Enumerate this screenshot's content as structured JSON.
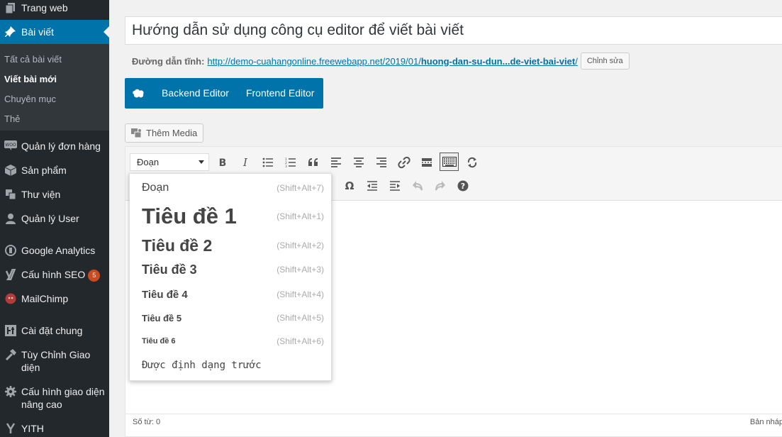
{
  "sidebar": {
    "items": [
      {
        "key": "pages",
        "icon": "pages-icon",
        "label": "Trang web"
      },
      {
        "key": "posts",
        "icon": "pin-icon",
        "label": "Bài viết"
      },
      {
        "key": "orders",
        "icon": "woo-icon",
        "label": "Quản lý đơn hàng"
      },
      {
        "key": "products",
        "icon": "box-icon",
        "label": "Sản phẩm"
      },
      {
        "key": "media",
        "icon": "media-icon",
        "label": "Thư viện"
      },
      {
        "key": "users",
        "icon": "user-icon",
        "label": "Quản lý User"
      },
      {
        "key": "analytics",
        "icon": "analytics-icon",
        "label": "Google Analytics"
      },
      {
        "key": "seo",
        "icon": "yoast-icon",
        "label": "Cấu hình SEO",
        "badge": "5"
      },
      {
        "key": "mailchimp",
        "icon": "mailchimp-icon",
        "label": "MailChimp"
      },
      {
        "key": "settings",
        "icon": "settings-icon",
        "label": "Cài đặt chung"
      },
      {
        "key": "customize",
        "icon": "hammer-icon",
        "label": "Tùy Chỉnh Giao diện"
      },
      {
        "key": "advanced",
        "icon": "gear-icon",
        "label": "Cấu hình giao diện nâng cao"
      },
      {
        "key": "yith",
        "icon": "yith-icon",
        "label": "YITH"
      }
    ],
    "submenu": [
      {
        "label": "Tất cả bài viết",
        "active": false
      },
      {
        "label": "Viết bài mới",
        "active": true
      },
      {
        "label": "Chuyên mục",
        "active": false
      },
      {
        "label": "Thẻ",
        "active": false
      }
    ]
  },
  "post": {
    "title": "Hướng dẫn sử dụng công cụ editor để viết bài viết",
    "permalink_label": "Đường dẫn tĩnh:",
    "permalink_base": "http://demo-cuahangonline.freewebapp.net/2019/01/",
    "permalink_slug": "huong-dan-su-dun...de-viet-bai-viet",
    "permalink_end": "/",
    "edit_label": "Chỉnh sửa"
  },
  "composer": {
    "backend": "Backend Editor",
    "frontend": "Frontend Editor"
  },
  "add_media": "Thêm Media",
  "toolbar": {
    "format_value": "Đoạn",
    "row1": [
      "bold-icon",
      "italic-icon",
      "bullet-list-icon",
      "numbered-list-icon",
      "blockquote-icon",
      "align-left-icon",
      "align-center-icon",
      "align-right-icon",
      "link-icon",
      "read-more-icon",
      "toolbar-toggle-icon",
      "composer-toggle-icon"
    ],
    "row2": [
      "omega-icon",
      "outdent-icon",
      "indent-icon",
      "undo-icon",
      "redo-icon",
      "help-icon"
    ]
  },
  "format_menu": [
    {
      "label": "Đoạn",
      "shortcut": "(Shift+Alt+7)"
    },
    {
      "label": "Tiêu đề 1",
      "shortcut": "(Shift+Alt+1)"
    },
    {
      "label": "Tiêu đề 2",
      "shortcut": "(Shift+Alt+2)"
    },
    {
      "label": "Tiêu đề 3",
      "shortcut": "(Shift+Alt+3)"
    },
    {
      "label": "Tiêu đề 4",
      "shortcut": "(Shift+Alt+4)"
    },
    {
      "label": "Tiêu đề 5",
      "shortcut": "(Shift+Alt+5)"
    },
    {
      "label": "Tiêu đề 6",
      "shortcut": "(Shift+Alt+6)"
    },
    {
      "label": "Được định dạng trước",
      "shortcut": ""
    }
  ],
  "status": {
    "word_count": "Số từ: 0",
    "saved": "Bản nháp"
  },
  "colors": {
    "sidebar_bg": "#23282d",
    "accent": "#0073aa",
    "badge": "#ca4a1f"
  }
}
